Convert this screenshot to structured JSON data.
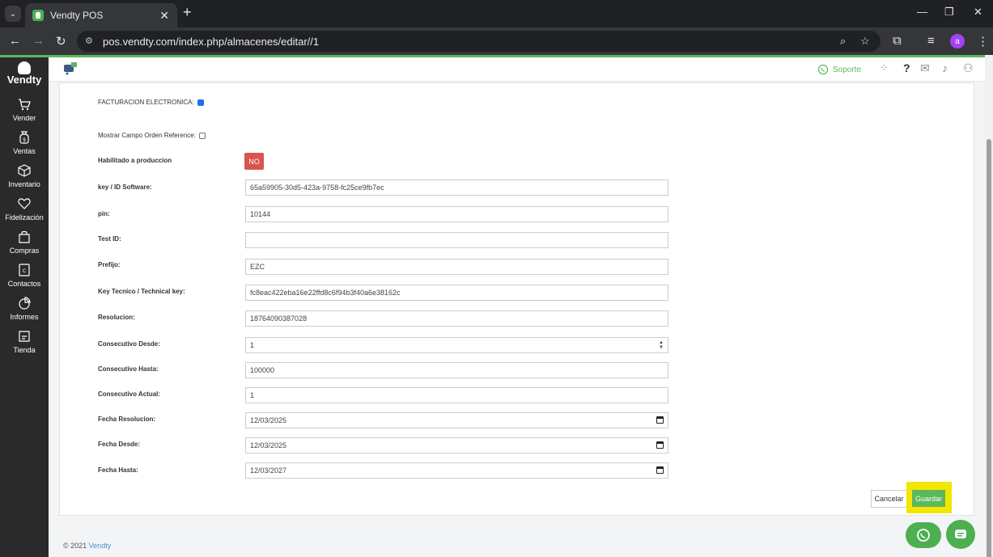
{
  "browser": {
    "tab_title": "Vendty POS",
    "url": "pos.vendty.com/index.php/almacenes/editar//1",
    "profile_initial": "a"
  },
  "sidebar": {
    "logo": "Vendty",
    "items": [
      {
        "label": "Vender",
        "icon": "cart-icon"
      },
      {
        "label": "Ventas",
        "icon": "money-bag-icon"
      },
      {
        "label": "Inventario",
        "icon": "box-icon"
      },
      {
        "label": "Fidelización",
        "icon": "heart-icon"
      },
      {
        "label": "Compras",
        "icon": "shopping-bag-icon"
      },
      {
        "label": "Contactos",
        "icon": "contacts-icon"
      },
      {
        "label": "Informes",
        "icon": "pie-chart-icon"
      },
      {
        "label": "Tienda",
        "icon": "store-icon"
      }
    ]
  },
  "header": {
    "support": "Soporte"
  },
  "form": {
    "facturacion_label": "FACTURACION ELECTRONICA:",
    "mostrar_label": "Mostrar Campo Orden Reference:",
    "habilitado_label": "Habilitado a produccion",
    "habilitado_value": "NO",
    "fields": [
      {
        "label": "key / ID Software:",
        "value": "65a59905-30d5-423a-9758-fc25ce9fb7ec"
      },
      {
        "label": "pin:",
        "value": "10144"
      },
      {
        "label": "Test ID:",
        "value": ""
      },
      {
        "label": "Prefijo:",
        "value": "EZC"
      },
      {
        "label": "Key Tecnico / Technical key:",
        "value": "fc8eac422eba16e22ffd8c6f94b3f40a6e38162c"
      },
      {
        "label": "Resolucion:",
        "value": "18764090387028"
      },
      {
        "label": "Consecutivo Desde:",
        "value": "1"
      },
      {
        "label": "Consecutivo Hasta:",
        "value": "100000"
      },
      {
        "label": "Consecutivo Actual:",
        "value": "1"
      },
      {
        "label": "Fecha Resolucion:",
        "value": "12/03/2025"
      },
      {
        "label": "Fecha Desde:",
        "value": "12/03/2025"
      },
      {
        "label": "Fecha Hasta:",
        "value": "12/03/2027"
      }
    ],
    "cancel_label": "Cancelar",
    "save_label": "Guardar"
  },
  "footer": {
    "copyright": "© 2021",
    "brand": "Vendty"
  },
  "colors": {
    "accent_green": "#5cb85c",
    "danger_red": "#d9534f",
    "highlight_yellow": "#f3e600",
    "sidebar_bg": "#2a2a2a"
  }
}
